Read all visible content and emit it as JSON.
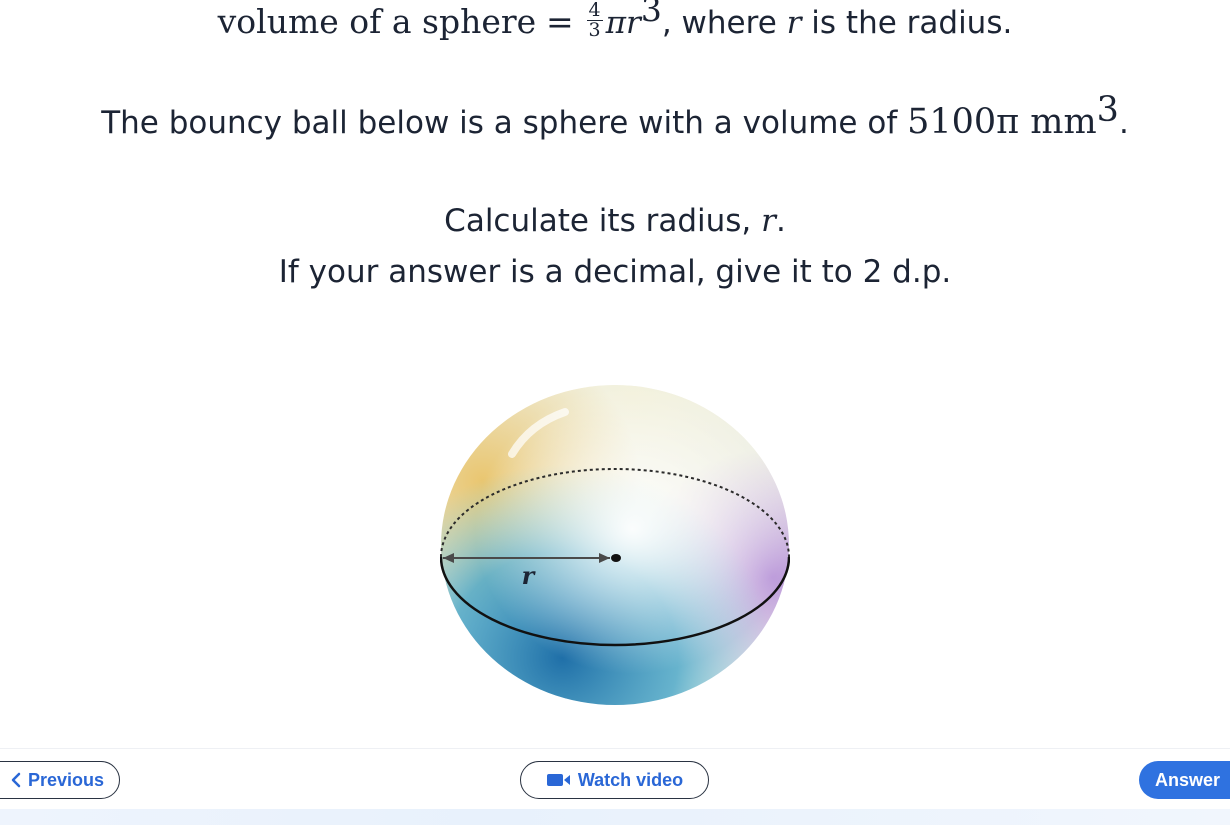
{
  "question": {
    "formula_lhs": "volume of a sphere",
    "formula_eq": "=",
    "formula_num": "4",
    "formula_den": "3",
    "formula_pi": "π",
    "formula_r": "r",
    "formula_exp": "3",
    "formula_tail_comma": ",",
    "formula_tail": " where ",
    "formula_tail_r": "r",
    "formula_tail_end": " is the radius.",
    "statement_text": "The bouncy ball below is a sphere with a volume of ",
    "statement_value": "5100π mm",
    "statement_exp": "3",
    "statement_end": ".",
    "task_text": "Calculate its radius, ",
    "task_r": "r",
    "task_end": ".",
    "instruction": "If your answer is a decimal, give it to 2 d.p."
  },
  "diagram": {
    "radius_label": "r"
  },
  "footer": {
    "previous_label": "Previous",
    "video_label": "Watch video",
    "answer_label": "Answer"
  },
  "colors": {
    "accent": "#2f72e0",
    "link": "#2a67d6",
    "text": "#1c2434"
  },
  "icons": {
    "previous": "chevron-left-icon",
    "video": "video-camera-icon"
  }
}
